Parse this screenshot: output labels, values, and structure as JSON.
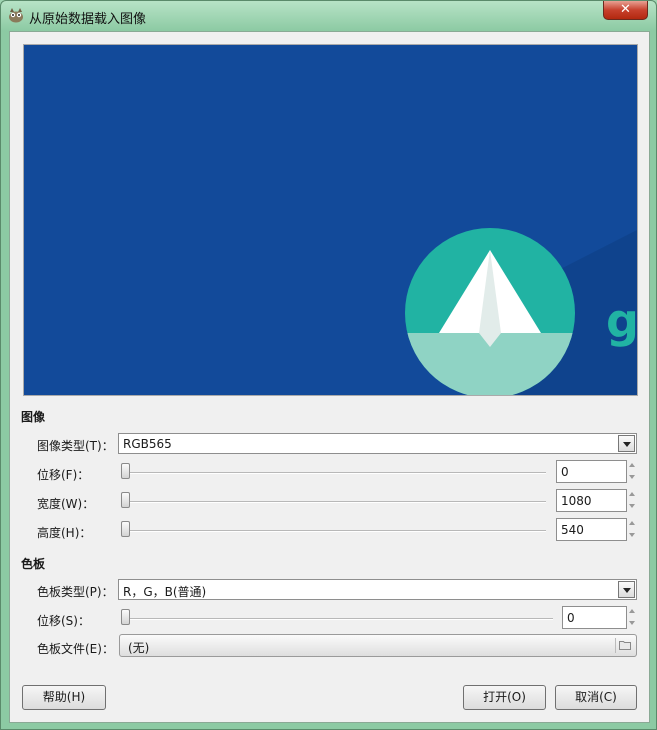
{
  "window": {
    "title": "从原始数据载入图像",
    "close_label": "✕"
  },
  "image_section": {
    "label": "图像",
    "type_label": "图像类型(T)：",
    "type_value": "RGB565",
    "offset_label": "位移(F)：",
    "offset_value": "0",
    "width_label": "宽度(W)：",
    "width_value": "1080",
    "height_label": "高度(H)：",
    "height_value": "540"
  },
  "palette_section": {
    "label": "色板",
    "type_label": "色板类型(P)：",
    "type_value": "R，G，B(普通)",
    "offset_label": "位移(S)：",
    "offset_value": "0",
    "file_label": "色板文件(E)：",
    "file_value": "(无)"
  },
  "buttons": {
    "help": "帮助(H)",
    "open": "打开(O)",
    "cancel": "取消(C)"
  },
  "preview": {
    "glyph": "g"
  },
  "colors": {
    "preview_bg": "#124a9a",
    "circle": "#21b3a3",
    "circle_lower": "#8fd3c4",
    "glyph": "#21b3a3"
  },
  "icons": [
    "gimp-icon",
    "close-icon",
    "chevron-down-icon",
    "spin-up-icon",
    "spin-down-icon",
    "folder-icon"
  ]
}
